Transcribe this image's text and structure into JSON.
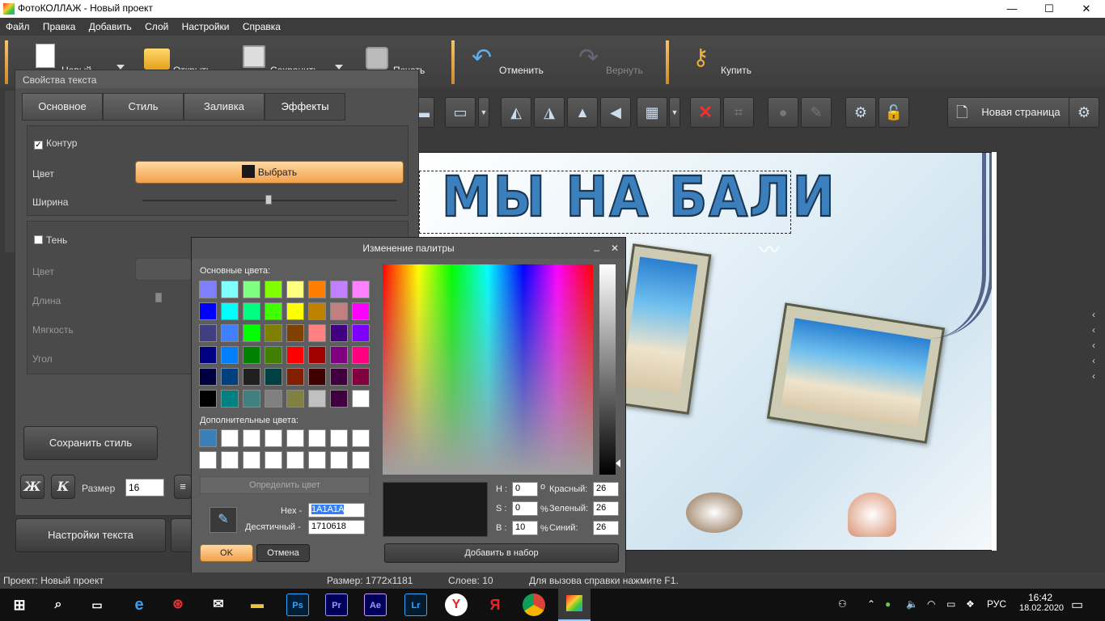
{
  "titlebar": {
    "title": "ФотоКОЛЛАЖ - Новый проект",
    "min": "—",
    "max": "☐",
    "close": "✕"
  },
  "menu": [
    "Файл",
    "Правка",
    "Добавить",
    "Слой",
    "Настройки",
    "Справка"
  ],
  "toolbar": {
    "new": "Новый",
    "open": "Открыть",
    "save": "Сохранить",
    "print": "Печать",
    "undo": "Отменить",
    "redo": "Вернуть",
    "buy": "Купить"
  },
  "toolbar2": {
    "new_page": "Новая страница"
  },
  "canvas": {
    "heading": "МЫ НА БАЛИ"
  },
  "props": {
    "title": "Свойства текста",
    "tabs": [
      "Основное",
      "Стиль",
      "Заливка",
      "Эффекты"
    ],
    "contour": "Контур",
    "color": "Цвет",
    "choose": "Выбрать",
    "width": "Ширина",
    "shadow": "Тень",
    "shadow_color": "Цвет",
    "length": "Длина",
    "softness": "Мягкость",
    "angle": "Угол",
    "save_style": "Сохранить стиль",
    "bold": "Ж",
    "italic": "К",
    "size_label": "Размер",
    "size_value": "16",
    "text_settings": "Настройки текста"
  },
  "palette": {
    "title": "Изменение палитры",
    "min": "_",
    "close": "✕",
    "basic": "Основные цвета:",
    "custom": "Дополнительные цвета:",
    "define": "Определить цвет",
    "hex_label": "Hex -",
    "hex_value": "1A1A1A",
    "dec_label": "Десятичный -",
    "dec_value": "1710618",
    "h_label": "H :",
    "h_value": "0",
    "h_unit": "о",
    "s_label": "S :",
    "s_value": "0",
    "s_unit": "%",
    "b_label": "B :",
    "b_value": "10",
    "b_unit": "%",
    "red_label": "Красный:",
    "red_value": "26",
    "green_label": "Зеленый:",
    "green_value": "26",
    "blue_label": "Синий:",
    "blue_value": "26",
    "ok": "OK",
    "cancel": "Отмена",
    "add": "Добавить в набор",
    "basic_colors": [
      "#8080ff",
      "#80ffff",
      "#80ff80",
      "#80ff00",
      "#ffff80",
      "#ff8000",
      "#c080ff",
      "#ff80ff",
      "#0000ff",
      "#00ffff",
      "#00ff80",
      "#40ff00",
      "#ffff00",
      "#c08000",
      "#c08080",
      "#ff00ff",
      "#404080",
      "#4080ff",
      "#00ff00",
      "#808000",
      "#804000",
      "#ff8080",
      "#400080",
      "#8000ff",
      "#000080",
      "#0080ff",
      "#008000",
      "#408000",
      "#ff0000",
      "#a00000",
      "#800080",
      "#ff0080",
      "#000040",
      "#004080",
      "#202020",
      "#004040",
      "#802000",
      "#400000",
      "#400040",
      "#800040",
      "#000000",
      "#008080",
      "#408080",
      "#808080",
      "#808040",
      "#c0c0c0",
      "#400040",
      "#ffffff"
    ],
    "custom_colors": [
      "#3a7fb8",
      "#ffffff",
      "#ffffff",
      "#ffffff",
      "#ffffff",
      "#ffffff",
      "#ffffff",
      "#ffffff",
      "#ffffff",
      "#ffffff",
      "#ffffff",
      "#ffffff",
      "#ffffff",
      "#ffffff",
      "#ffffff",
      "#ffffff"
    ],
    "preview_color": "#1a1a1a"
  },
  "status": {
    "project": "Проект:  Новый проект",
    "size": "Размер:  1772x1181",
    "layers": "Слоев:   10",
    "help": "Для вызова справки нажмите F1."
  },
  "taskbar": {
    "apps": [
      "Ps",
      "Pr",
      "Ae",
      "Lr"
    ],
    "lang": "РУС",
    "time": "16:42",
    "date": "18.02.2020"
  }
}
